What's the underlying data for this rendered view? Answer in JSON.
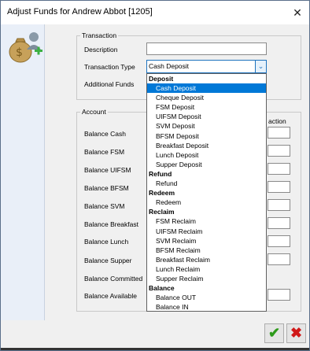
{
  "window": {
    "title": "Adjust Funds for Andrew Abbot [1205]",
    "close_glyph": "✕"
  },
  "icon": "money-bag-user-add-icon",
  "transaction": {
    "group_label": "Transaction",
    "description_label": "Description",
    "description_value": "",
    "type_label": "Transaction Type",
    "type_value": "Cash Deposit",
    "additional_funds_label": "Additional Funds"
  },
  "account": {
    "group_label": "Account",
    "column_fragment": "action",
    "rows": [
      "Balance Cash",
      "Balance FSM",
      "Balance UIFSM",
      "Balance BFSM",
      "Balance SVM",
      "Balance Breakfast",
      "Balance Lunch",
      "Balance Supper",
      "Balance Committed",
      "Balance Available"
    ]
  },
  "dropdown": [
    {
      "text": "Deposit",
      "head": true
    },
    {
      "text": "Cash Deposit",
      "selected": true
    },
    {
      "text": "Cheque Deposit"
    },
    {
      "text": "FSM Deposit"
    },
    {
      "text": "UIFSM Deposit"
    },
    {
      "text": "SVM Deposit"
    },
    {
      "text": "BFSM Deposit"
    },
    {
      "text": "Breakfast Deposit"
    },
    {
      "text": "Lunch Deposit"
    },
    {
      "text": "Supper Deposit"
    },
    {
      "text": "Refund",
      "head": true
    },
    {
      "text": "Refund"
    },
    {
      "text": "Redeem",
      "head": true
    },
    {
      "text": "Redeem"
    },
    {
      "text": "Reclaim",
      "head": true
    },
    {
      "text": "FSM Reclaim"
    },
    {
      "text": "UIFSM Reclaim"
    },
    {
      "text": "SVM Reclaim"
    },
    {
      "text": "BFSM Reclaim"
    },
    {
      "text": "Breakfast Reclaim"
    },
    {
      "text": "Lunch Reclaim"
    },
    {
      "text": "Supper Reclaim"
    },
    {
      "text": "Balance",
      "head": true
    },
    {
      "text": "Balance OUT"
    },
    {
      "text": "Balance IN"
    }
  ],
  "buttons": {
    "ok_glyph": "✔",
    "cancel_glyph": "✖",
    "ok_icon": "checkmark-icon",
    "cancel_icon": "cross-icon"
  },
  "colors": {
    "selection": "#0078d7",
    "ok": "#2d9a1a",
    "cancel": "#d01818",
    "focus_border": "#1e73be"
  }
}
